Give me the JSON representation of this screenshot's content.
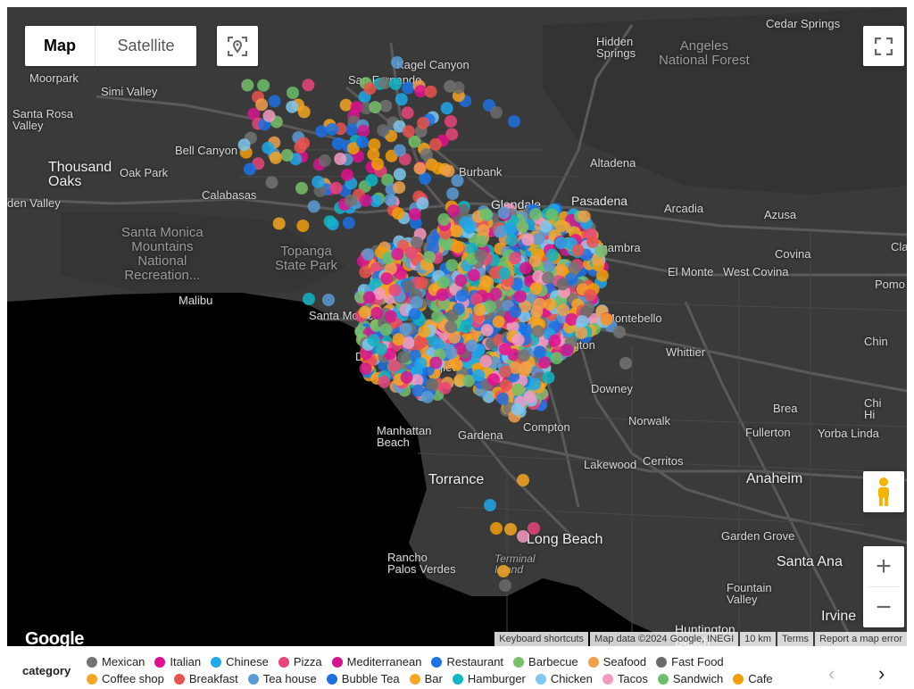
{
  "map_type": {
    "map_label": "Map",
    "satellite_label": "Satellite"
  },
  "places": [
    {
      "name": "Cedar Springs",
      "cls": ""
    },
    {
      "name": "Kagel Canyon",
      "cls": ""
    },
    {
      "name": "Hidden\nSprings",
      "cls": ""
    },
    {
      "name": "Angeles\nNational Forest",
      "cls": "park"
    },
    {
      "name": "Moorpark",
      "cls": ""
    },
    {
      "name": "San Fernando",
      "cls": ""
    },
    {
      "name": "Simi Valley",
      "cls": ""
    },
    {
      "name": "Santa Rosa\nValley",
      "cls": ""
    },
    {
      "name": "Bell Canyon",
      "cls": ""
    },
    {
      "name": "Thousand\nOaks",
      "cls": "big"
    },
    {
      "name": "Oak Park",
      "cls": ""
    },
    {
      "name": "Burbank",
      "cls": ""
    },
    {
      "name": "Altadena",
      "cls": ""
    },
    {
      "name": "Calabasas",
      "cls": ""
    },
    {
      "name": "den Valley",
      "cls": ""
    },
    {
      "name": "Glendale",
      "cls": "mid"
    },
    {
      "name": "Pasadena",
      "cls": "mid"
    },
    {
      "name": "Arcadia",
      "cls": ""
    },
    {
      "name": "Azusa",
      "cls": ""
    },
    {
      "name": "Santa Monica\nMountains\nNational\nRecreation...",
      "cls": "park"
    },
    {
      "name": "Topanga\nState Park",
      "cls": "park"
    },
    {
      "name": "Alhambra",
      "cls": ""
    },
    {
      "name": "Covina",
      "cls": ""
    },
    {
      "name": "El Monte",
      "cls": ""
    },
    {
      "name": "West Covina",
      "cls": ""
    },
    {
      "name": "Pomo",
      "cls": ""
    },
    {
      "name": "Malibu",
      "cls": ""
    },
    {
      "name": "Santa Monica",
      "cls": ""
    },
    {
      "name": "Montebello",
      "cls": ""
    },
    {
      "name": "Whittier",
      "cls": ""
    },
    {
      "name": "Chin",
      "cls": ""
    },
    {
      "name": "Del Rey",
      "cls": ""
    },
    {
      "name": "Inglewood",
      "cls": ""
    },
    {
      "name": "Huntington\nPark",
      "cls": ""
    },
    {
      "name": "Downey",
      "cls": ""
    },
    {
      "name": "Brea",
      "cls": ""
    },
    {
      "name": "Chi\nHi",
      "cls": ""
    },
    {
      "name": "Norwalk",
      "cls": ""
    },
    {
      "name": "Manhattan\nBeach",
      "cls": ""
    },
    {
      "name": "Gardena",
      "cls": ""
    },
    {
      "name": "Compton",
      "cls": ""
    },
    {
      "name": "Fullerton",
      "cls": ""
    },
    {
      "name": "Yorba Linda",
      "cls": ""
    },
    {
      "name": "Lakewood",
      "cls": ""
    },
    {
      "name": "Cerritos",
      "cls": ""
    },
    {
      "name": "Torrance",
      "cls": "big"
    },
    {
      "name": "Anaheim",
      "cls": "big"
    },
    {
      "name": "Long Beach",
      "cls": "big"
    },
    {
      "name": "Garden Grove",
      "cls": ""
    },
    {
      "name": "Rancho\nPalos Verdes",
      "cls": ""
    },
    {
      "name": "Terminal\nIsland",
      "cls": "water"
    },
    {
      "name": "Santa Ana",
      "cls": "big"
    },
    {
      "name": "Fountain\nValley",
      "cls": ""
    },
    {
      "name": "Huntington\nBeach",
      "cls": "mid"
    },
    {
      "name": "Irvine",
      "cls": "big"
    },
    {
      "name": "Cla",
      "cls": ""
    }
  ],
  "colors": {
    "mexican": "#737373",
    "italian": "#e0108f",
    "chinese": "#1ea8e8",
    "pizza": "#e8457a",
    "mediterranean": "#d4168e",
    "restaurant": "#1a73e8",
    "barbecue": "#78c06a",
    "seafood": "#f0a04b",
    "fastfood": "#6b6b6b",
    "coffee": "#f5a623",
    "breakfast": "#e8534f",
    "teahouse": "#5b9bd5",
    "bubbletea": "#1f6fe0",
    "bar": "#f5a623",
    "hamburger": "#12b5c6",
    "chicken": "#7fc8f0",
    "tacos": "#f59ac1",
    "sandwich": "#6bbf6b",
    "cafe": "#f59e0b"
  },
  "legend": {
    "title": "category",
    "row1": [
      {
        "label": "Mexican",
        "color": "#737373"
      },
      {
        "label": "Italian",
        "color": "#e0108f"
      },
      {
        "label": "Chinese",
        "color": "#1ea8e8"
      },
      {
        "label": "Pizza",
        "color": "#e8457a"
      },
      {
        "label": "Mediterranean",
        "color": "#d4168e"
      },
      {
        "label": "Restaurant",
        "color": "#1a73e8"
      },
      {
        "label": "Barbecue",
        "color": "#78c06a"
      },
      {
        "label": "Seafood",
        "color": "#f0a04b"
      },
      {
        "label": "Fast Food",
        "color": "#6b6b6b"
      }
    ],
    "row2": [
      {
        "label": "Coffee shop",
        "color": "#f5a623"
      },
      {
        "label": "Breakfast",
        "color": "#e8534f"
      },
      {
        "label": "Tea house",
        "color": "#5b9bd5"
      },
      {
        "label": "Bubble Tea",
        "color": "#1f6fe0"
      },
      {
        "label": "Bar",
        "color": "#f5a623"
      },
      {
        "label": "Hamburger",
        "color": "#12b5c6"
      },
      {
        "label": "Chicken",
        "color": "#7fc8f0"
      },
      {
        "label": "Tacos",
        "color": "#f59ac1"
      },
      {
        "label": "Sandwich",
        "color": "#6bbf6b"
      },
      {
        "label": "Cafe",
        "color": "#f59e0b"
      }
    ]
  },
  "attribution": {
    "shortcuts": "Keyboard shortcuts",
    "data": "Map data ©2024 Google, INEGI",
    "scale": "10 km",
    "terms": "Terms",
    "report": "Report a map error"
  },
  "logo": "Google",
  "icons": {
    "location": "location-target-icon",
    "fullscreen": "fullscreen-icon",
    "pegman": "pegman-icon",
    "zoom_in": "+",
    "zoom_out": "−",
    "prev": "‹",
    "next": "›"
  }
}
